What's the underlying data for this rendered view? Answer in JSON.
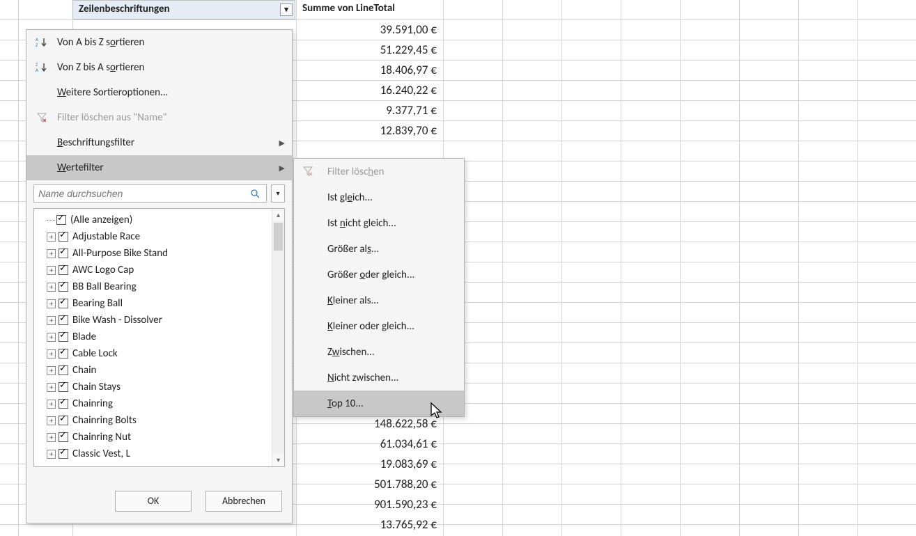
{
  "pivot": {
    "row_header": "Zeilenbeschriftungen",
    "value_header": "Summe von LineTotal",
    "values_before": [
      "39.591,00 €",
      "51.229,45 €",
      "18.406,97 €",
      "16.240,22 €",
      "9.377,71 €",
      "12.839,70 €"
    ],
    "values_after": [
      "148.622,58 €",
      "61.034,61 €",
      "19.083,69 €",
      "501.788,20 €",
      "901.590,23 €",
      "13.765,92 €"
    ]
  },
  "dropdown": {
    "sort_asc": "Von A bis Z sortieren",
    "sort_desc": "Von Z bis A sortieren",
    "more_sort": "Weitere Sortieroptionen...",
    "clear_filter": "Filter löschen aus \"Name\"",
    "label_filter": "Beschriftungsfilter",
    "value_filter": "Wertefilter",
    "search_placeholder": "Name durchsuchen",
    "ok": "OK",
    "cancel": "Abbrechen"
  },
  "tree": {
    "select_all": "(Alle anzeigen)",
    "items": [
      "Adjustable Race",
      "All-Purpose Bike Stand",
      "AWC Logo Cap",
      "BB Ball Bearing",
      "Bearing Ball",
      "Bike Wash - Dissolver",
      "Blade",
      "Cable Lock",
      "Chain",
      "Chain Stays",
      "Chainring",
      "Chainring Bolts",
      "Chainring Nut",
      "Classic Vest, L"
    ]
  },
  "submenu": {
    "clear": "Filter löschen",
    "eq": "Ist gleich...",
    "neq": "Ist nicht gleich...",
    "gt": "Größer als...",
    "gte": "Größer oder gleich...",
    "lt": "Kleiner als...",
    "lte": "Kleiner oder gleich...",
    "between": "Zwischen...",
    "not_between": "Nicht zwischen...",
    "top10": "Top 10..."
  }
}
